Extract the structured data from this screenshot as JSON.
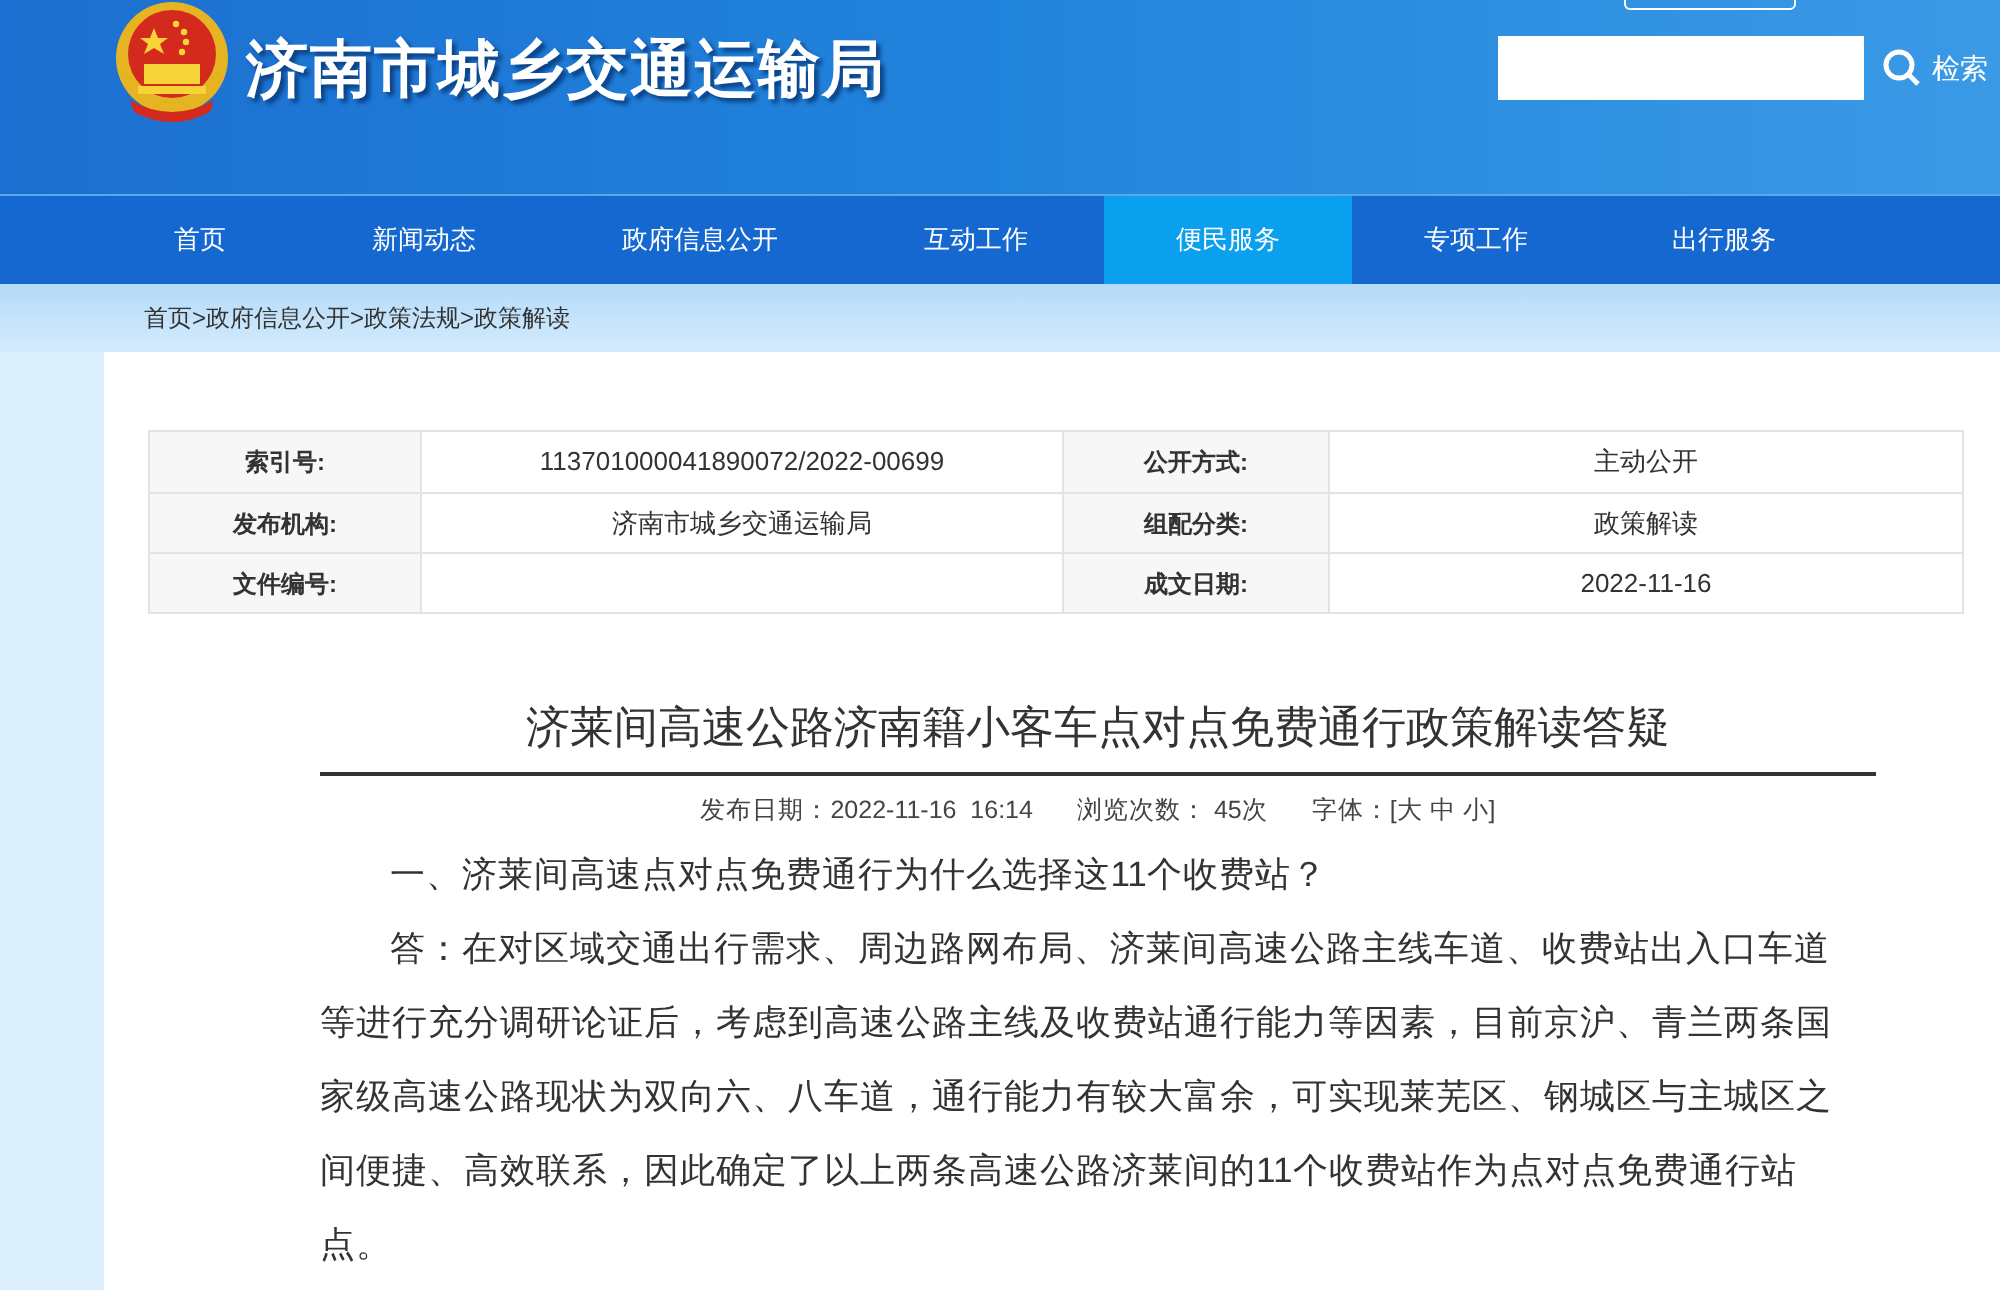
{
  "header": {
    "site_title": "济南市城乡交通运输局",
    "search": {
      "button": "检索"
    }
  },
  "nav": [
    {
      "label": "首页",
      "selected": false
    },
    {
      "label": "新闻动态",
      "selected": false
    },
    {
      "label": "政府信息公开",
      "selected": false
    },
    {
      "label": "互动工作",
      "selected": false
    },
    {
      "label": "便民服务",
      "selected": true
    },
    {
      "label": "专项工作",
      "selected": false
    },
    {
      "label": "出行服务",
      "selected": false
    }
  ],
  "breadcrumb": {
    "items": [
      "首页",
      "政府信息公开",
      "政策法规",
      "政策解读"
    ],
    "separator": ">"
  },
  "info_table": {
    "rows": [
      [
        {
          "label": "索引号:",
          "value": "113701000041890072/2022-00699"
        },
        {
          "label": "公开方式:",
          "value": "主动公开"
        }
      ],
      [
        {
          "label": "发布机构:",
          "value": "济南市城乡交通运输局"
        },
        {
          "label": "组配分类:",
          "value": "政策解读"
        }
      ],
      [
        {
          "label": "文件编号:"
        },
        {
          "label": "成文日期:",
          "value": "2022-11-16"
        }
      ]
    ]
  },
  "article": {
    "title": "济莱间高速公路济南籍小客车点对点免费通行政策解读答疑",
    "meta": {
      "date": "发布日期：2022-11-16  16:14",
      "views": "浏览次数： 45次",
      "font_size": "字体：[大 中 小]"
    },
    "paragraphs": [
      "一、济莱间高速点对点免费通行为什么选择这11个收费站？",
      "答：在对区域交通出行需求、周边路网布局、济莱间高速公路主线车道、收费站出入口车道等进行充分调研论证后，考虑到高速公路主线及收费站通行能力等因素，目前京沪、青兰两条国家级高速公路现状为双向六、八车道，通行能力有较大富余，可实现莱芜区、钢城区与主城区之间便捷、高效联系，因此确定了以上两条高速公路济莱间的11个收费站作为点对点免费通行站点。"
    ]
  }
}
